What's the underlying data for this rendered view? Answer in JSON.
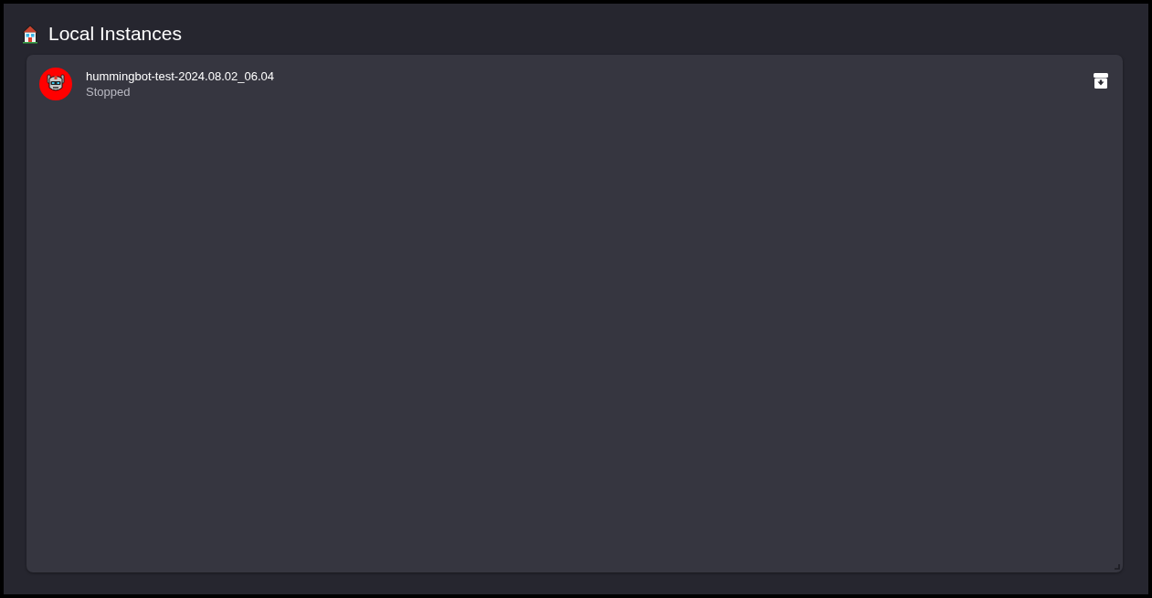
{
  "header": {
    "title": "Local Instances"
  },
  "instances": [
    {
      "name": "hummingbot-test-2024.08.02_06.04",
      "status": "Stopped"
    }
  ]
}
